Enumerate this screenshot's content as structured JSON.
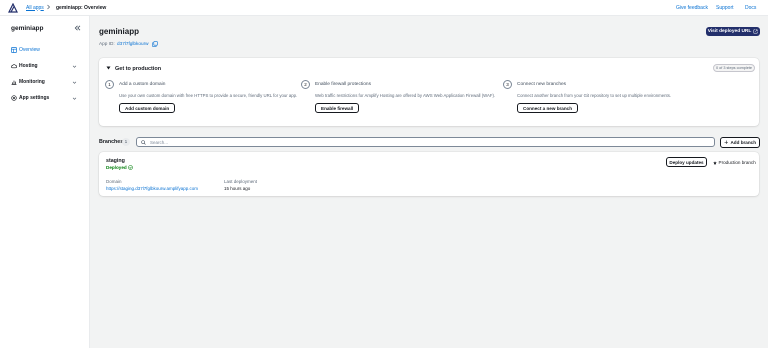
{
  "header": {
    "logo_icon": "amplify-logo-icon",
    "breadcrumb_root": "All apps",
    "breadcrumb_current": "geminiapp: Overview",
    "links": [
      "Give feedback",
      "Support",
      "Docs"
    ]
  },
  "sidebar": {
    "app_title": "geminiapp",
    "items": [
      {
        "label": "Overview",
        "icon": "overview-icon",
        "active": true
      },
      {
        "label": "Hosting",
        "icon": "cloud-icon",
        "expandable": true
      },
      {
        "label": "Monitoring",
        "icon": "chart-icon",
        "expandable": true
      },
      {
        "label": "App settings",
        "icon": "gear-icon",
        "expandable": true
      }
    ]
  },
  "main": {
    "app_name": "geminiapp",
    "app_id_label": "App ID:",
    "app_id_value": "d37l7fglbkourw",
    "visit_button": "Visit deployed URL",
    "production": {
      "title": "Get to production",
      "badge": "0 of 3 steps complete",
      "steps": [
        {
          "number": "1",
          "title": "Add a custom domain",
          "desc": "Use your own custom domain with free HTTPS to provide a secure, friendly URL for your app.",
          "button": "Add custom domain"
        },
        {
          "number": "2",
          "title": "Enable firewall protections",
          "desc": "Web traffic restrictions for Amplify Hosting are offered by AWS Web Application Firewall (WAF).",
          "button": "Enable firewall"
        },
        {
          "number": "3",
          "title": "Connect new branches",
          "desc": "Connect another branch from your Git repository to set up multiple environments.",
          "button": "Connect a new branch"
        }
      ]
    },
    "branches": {
      "label": "Branches",
      "count": "1",
      "search_placeholder": "Search...",
      "add_button": "Add branch"
    },
    "branch": {
      "name": "staging",
      "status": "Deployed",
      "status_color": "#037f0c",
      "domain_label": "Domain",
      "domain_value": "https://staging.d37l7fglbkourw.amplifyapp.com",
      "last_deploy_label": "Last deployment",
      "last_deploy_value": "15 hours ago",
      "deploy_button": "Deploy updates",
      "production_label": "Production branch"
    }
  },
  "colors": {
    "accent": "#0972d3",
    "primary_button": "#232f6b",
    "success": "#037f0c"
  }
}
